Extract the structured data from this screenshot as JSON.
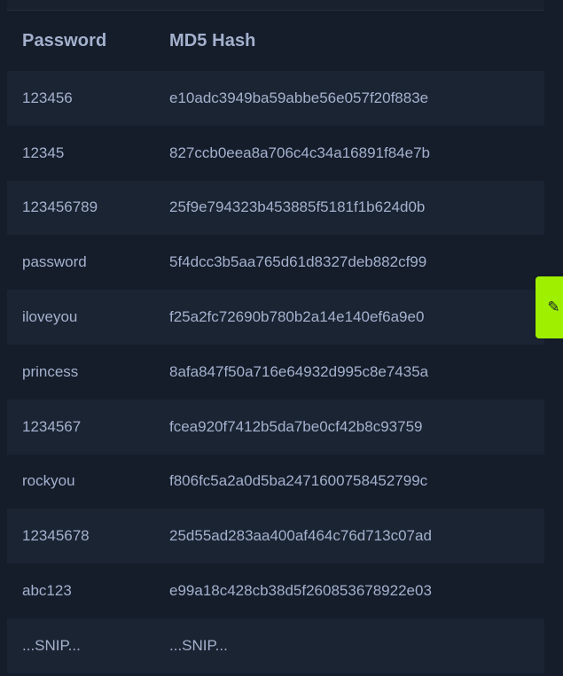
{
  "table": {
    "headers": [
      "Password",
      "MD5 Hash"
    ],
    "rows": [
      {
        "password": "123456",
        "hash": "e10adc3949ba59abbe56e057f20f883e"
      },
      {
        "password": "12345",
        "hash": "827ccb0eea8a706c4c34a16891f84e7b"
      },
      {
        "password": "123456789",
        "hash": "25f9e794323b453885f5181f1b624d0b"
      },
      {
        "password": "password",
        "hash": "5f4dcc3b5aa765d61d8327deb882cf99"
      },
      {
        "password": "iloveyou",
        "hash": "f25a2fc72690b780b2a14e140ef6a9e0"
      },
      {
        "password": "princess",
        "hash": "8afa847f50a716e64932d995c8e7435a"
      },
      {
        "password": "1234567",
        "hash": "fcea920f7412b5da7be0cf42b8c93759"
      },
      {
        "password": "rockyou",
        "hash": "f806fc5a2a0d5ba2471600758452799c"
      },
      {
        "password": "12345678",
        "hash": "25d55ad283aa400af464c76d713c07ad"
      },
      {
        "password": "abc123",
        "hash": "e99a18c428cb38d5f260853678922e03"
      },
      {
        "password": "...SNIP...",
        "hash": "...SNIP..."
      }
    ]
  },
  "edit_tab": {
    "icon": "pencil-icon",
    "glyph": "✎",
    "color": "#9fef00"
  },
  "colors": {
    "background": "#151d2b",
    "row_alt": "#1b2433",
    "text": "#a4b1cd"
  }
}
